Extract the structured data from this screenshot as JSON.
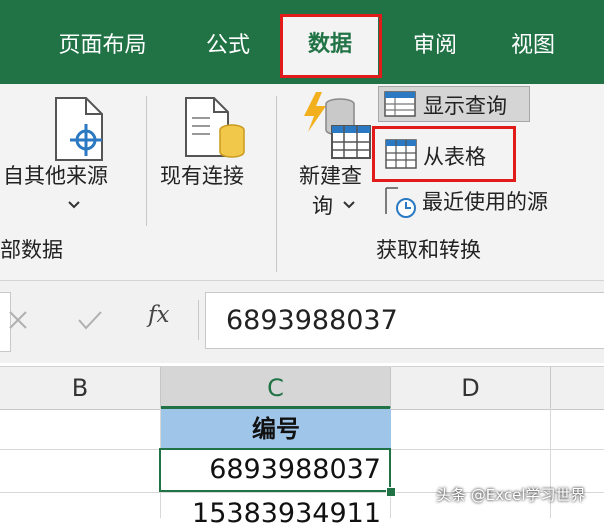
{
  "tabs": {
    "page_layout": "页面布局",
    "formulas": "公式",
    "data": "数据",
    "review": "审阅",
    "view": "视图"
  },
  "ribbon": {
    "from_other_sources": "自其他来源",
    "existing_connections": "现有连接",
    "new_query_line1": "新建查",
    "new_query_line2": "询",
    "show_queries": "显示查询",
    "from_table": "从表格",
    "recent_sources": "最近使用的源",
    "group_external": "部数据",
    "group_get_transform": "获取和转换"
  },
  "formula_bar": {
    "fx": "fx",
    "value": "6893988037"
  },
  "grid": {
    "columns": [
      "B",
      "C",
      "D"
    ],
    "header_cell": "编号",
    "selected_cell": "6893988037",
    "next_cell": "15383934911"
  },
  "watermark": "头条 @Excel学习世界",
  "colors": {
    "accent": "#217346",
    "highlight": "#e11a1a",
    "header_fill": "#9fc5e8"
  }
}
